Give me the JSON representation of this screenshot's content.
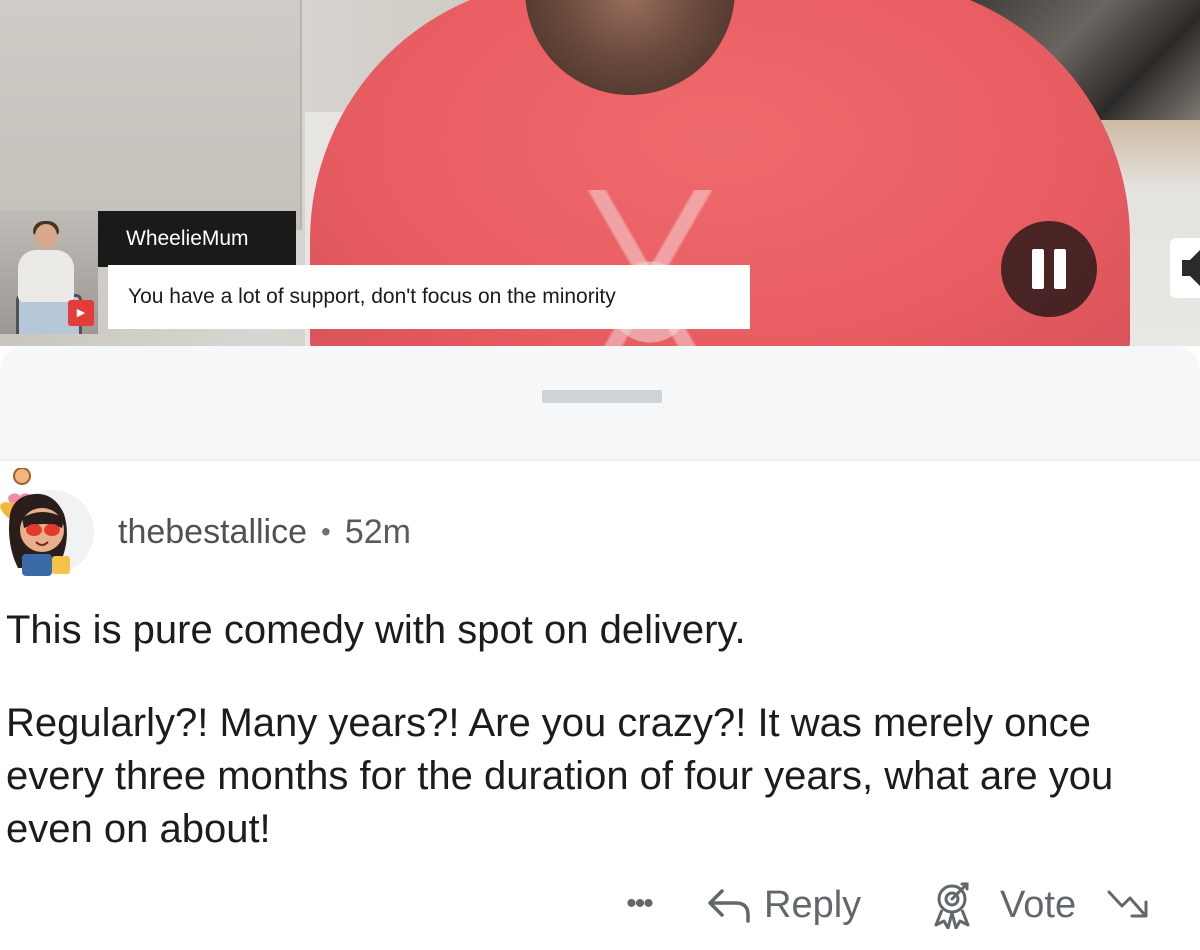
{
  "video": {
    "chat_overlay": {
      "username": "WheelieMum",
      "message": "You have a lot of support, don't focus on the minority"
    },
    "controls": {
      "pause_icon": "pause-icon",
      "volume_icon": "speaker-icon"
    }
  },
  "comment": {
    "username": "thebestallice",
    "separator": "•",
    "time_ago": "52m",
    "paragraphs": [
      "This is pure comedy with spot on delivery.",
      "Regularly?! Many years?! Are you crazy?! It was merely once every three months for the duration of four years, what are you even on about!"
    ],
    "actions": {
      "more_label": "•••",
      "reply_label": "Reply",
      "award_icon": "award-icon",
      "vote_label": "Vote",
      "vote_icon": "trend-down-icon"
    }
  },
  "colors": {
    "chat_name_bg": "#1a1a1a",
    "shirt": "#e85d62",
    "meta_text": "#575b5e",
    "body_text": "#1c1c1c",
    "action_text": "#62676b",
    "sheet_bg": "#f6f7f8"
  }
}
